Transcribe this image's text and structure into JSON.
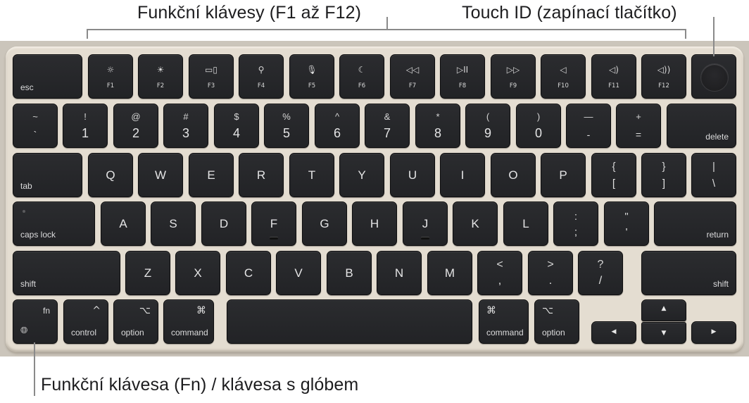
{
  "callouts": {
    "function_keys": "Funkční klávesy (F1 až F12)",
    "touch_id": "Touch ID (zapínací tlačítko)",
    "fn_globe": "Funkční klávesa (Fn) / klávesa s glóbem"
  },
  "colors": {
    "key": "#222326",
    "body": "#e4ddd1",
    "leader_line": "#8a8a8a",
    "text": "#1d1d1f"
  },
  "function_row": {
    "esc": "esc",
    "keys": [
      {
        "label": "F1",
        "icon": "brightness-down-icon",
        "glyph": "☼"
      },
      {
        "label": "F2",
        "icon": "brightness-up-icon",
        "glyph": "☀"
      },
      {
        "label": "F3",
        "icon": "mission-control-icon",
        "glyph": "▭▯"
      },
      {
        "label": "F4",
        "icon": "search-icon",
        "glyph": "⚲"
      },
      {
        "label": "F5",
        "icon": "microphone-icon",
        "glyph": "🎙︎"
      },
      {
        "label": "F6",
        "icon": "do-not-disturb-moon-icon",
        "glyph": "☾"
      },
      {
        "label": "F7",
        "icon": "rewind-icon",
        "glyph": "◁◁"
      },
      {
        "label": "F8",
        "icon": "play-pause-icon",
        "glyph": "▷II"
      },
      {
        "label": "F9",
        "icon": "fast-forward-icon",
        "glyph": "▷▷"
      },
      {
        "label": "F10",
        "icon": "mute-icon",
        "glyph": "◁"
      },
      {
        "label": "F11",
        "icon": "volume-down-icon",
        "glyph": "◁)"
      },
      {
        "label": "F12",
        "icon": "volume-up-icon",
        "glyph": "◁))"
      }
    ],
    "touch_id": "touch-id-icon"
  },
  "number_row": {
    "keys": [
      {
        "top": "~",
        "bottom": "`"
      },
      {
        "top": "!",
        "bottom": "1"
      },
      {
        "top": "@",
        "bottom": "2"
      },
      {
        "top": "#",
        "bottom": "3"
      },
      {
        "top": "$",
        "bottom": "4"
      },
      {
        "top": "%",
        "bottom": "5"
      },
      {
        "top": "^",
        "bottom": "6"
      },
      {
        "top": "&",
        "bottom": "7"
      },
      {
        "top": "*",
        "bottom": "8"
      },
      {
        "top": "(",
        "bottom": "9"
      },
      {
        "top": ")",
        "bottom": "0"
      },
      {
        "top": "—",
        "bottom": "-"
      },
      {
        "top": "+",
        "bottom": "="
      }
    ],
    "delete": "delete"
  },
  "qwerty_row": {
    "tab": "tab",
    "letters": [
      "Q",
      "W",
      "E",
      "R",
      "T",
      "Y",
      "U",
      "I",
      "O",
      "P"
    ],
    "brackets": [
      {
        "top": "{",
        "bottom": "["
      },
      {
        "top": "}",
        "bottom": "]"
      }
    ],
    "backslash": {
      "top": "|",
      "bottom": "\\"
    }
  },
  "home_row": {
    "caps": "caps lock",
    "letters": [
      "A",
      "S",
      "D",
      "F",
      "G",
      "H",
      "J",
      "K",
      "L"
    ],
    "punct": [
      {
        "top": ":",
        "bottom": ";"
      },
      {
        "top": "\"",
        "bottom": "'"
      }
    ],
    "return": "return"
  },
  "shift_row": {
    "shift_left": "shift",
    "letters": [
      "Z",
      "X",
      "C",
      "V",
      "B",
      "N",
      "M"
    ],
    "punct": [
      {
        "top": "<",
        "bottom": ","
      },
      {
        "top": ">",
        "bottom": "."
      },
      {
        "top": "?",
        "bottom": "/"
      }
    ],
    "shift_right": "shift"
  },
  "bottom_row": {
    "fn": "fn",
    "globe": "🌐︎",
    "control": "control",
    "control_sym": "^",
    "option": "option",
    "option_sym": "⌥",
    "command": "command",
    "command_sym": "⌘",
    "arrows": {
      "left": "◀",
      "up": "▲",
      "down": "▼",
      "right": "▶"
    }
  }
}
